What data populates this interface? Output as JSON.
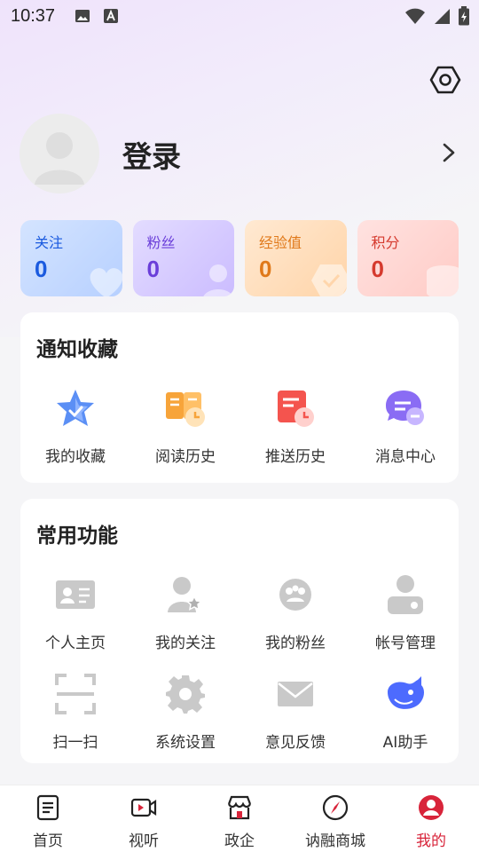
{
  "status_bar": {
    "time": "10:37"
  },
  "profile": {
    "login_label": "登录"
  },
  "stats": [
    {
      "label": "关注",
      "value": "0"
    },
    {
      "label": "粉丝",
      "value": "0"
    },
    {
      "label": "经验值",
      "value": "0"
    },
    {
      "label": "积分",
      "value": "0"
    }
  ],
  "notify_section": {
    "title": "通知收藏",
    "items": [
      {
        "label": "我的收藏",
        "icon": "star-icon"
      },
      {
        "label": "阅读历史",
        "icon": "book-clock-icon"
      },
      {
        "label": "推送历史",
        "icon": "push-clock-icon"
      },
      {
        "label": "消息中心",
        "icon": "message-icon"
      }
    ]
  },
  "common_section": {
    "title": "常用功能",
    "items": [
      {
        "label": "个人主页",
        "icon": "id-card-icon"
      },
      {
        "label": "我的关注",
        "icon": "user-star-icon"
      },
      {
        "label": "我的粉丝",
        "icon": "fans-icon"
      },
      {
        "label": "帐号管理",
        "icon": "account-gear-icon"
      },
      {
        "label": "扫一扫",
        "icon": "scan-icon"
      },
      {
        "label": "系统设置",
        "icon": "gear-icon"
      },
      {
        "label": "意见反馈",
        "icon": "mail-icon"
      },
      {
        "label": "AI助手",
        "icon": "ai-whale-icon"
      }
    ]
  },
  "tabbar": {
    "tabs": [
      {
        "label": "首页",
        "icon": "home-doc-icon"
      },
      {
        "label": "视听",
        "icon": "video-icon"
      },
      {
        "label": "政企",
        "icon": "store-icon"
      },
      {
        "label": "讷融商城",
        "icon": "compass-icon"
      },
      {
        "label": "我的",
        "icon": "user-icon",
        "active": true
      }
    ]
  },
  "colors": {
    "accent_red": "#d8243a",
    "follow_blue": "#1a5adf",
    "fans_purple": "#6b3fd9",
    "exp_orange": "#e0791a",
    "points_red": "#d53a2e"
  }
}
